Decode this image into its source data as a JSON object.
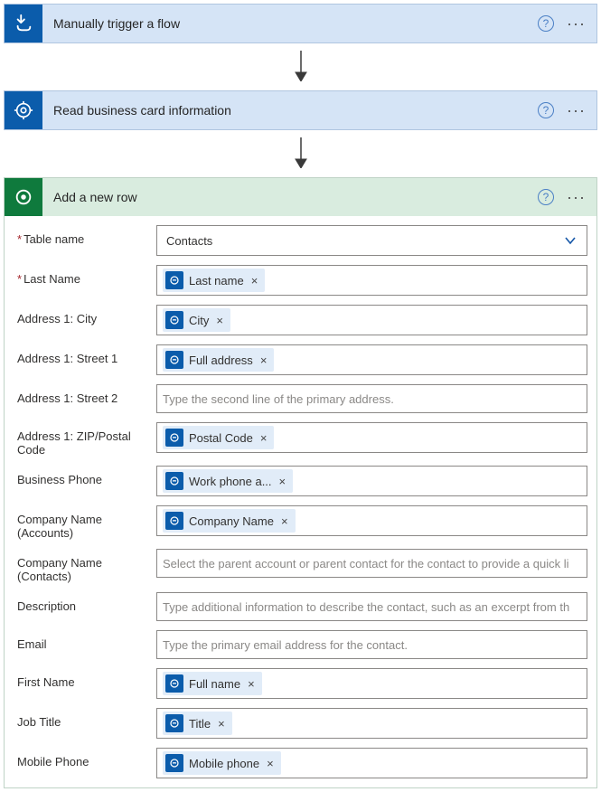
{
  "steps": {
    "trigger": {
      "title": "Manually trigger a flow"
    },
    "read": {
      "title": "Read business card information"
    },
    "addrow": {
      "title": "Add a new row"
    }
  },
  "form": {
    "table_name": {
      "label": "Table name",
      "value": "Contacts"
    },
    "last_name": {
      "label": "Last Name",
      "token": "Last name"
    },
    "city": {
      "label": "Address 1: City",
      "token": "City"
    },
    "street1": {
      "label": "Address 1: Street 1",
      "token": "Full address"
    },
    "street2": {
      "label": "Address 1: Street 2",
      "placeholder": "Type the second line of the primary address."
    },
    "zip": {
      "label": "Address 1: ZIP/Postal Code",
      "token": "Postal Code"
    },
    "bizphone": {
      "label": "Business Phone",
      "token": "Work phone a..."
    },
    "comp_acc": {
      "label": "Company Name (Accounts)",
      "token": "Company Name"
    },
    "comp_con": {
      "label": "Company Name (Contacts)",
      "placeholder": "Select the parent account or parent contact for the contact to provide a quick li"
    },
    "desc": {
      "label": "Description",
      "placeholder": "Type additional information to describe the contact, such as an excerpt from th"
    },
    "email": {
      "label": "Email",
      "placeholder": "Type the primary email address for the contact."
    },
    "first_name": {
      "label": "First Name",
      "token": "Full name"
    },
    "job": {
      "label": "Job Title",
      "token": "Title"
    },
    "mobile": {
      "label": "Mobile Phone",
      "token": "Mobile phone"
    }
  }
}
